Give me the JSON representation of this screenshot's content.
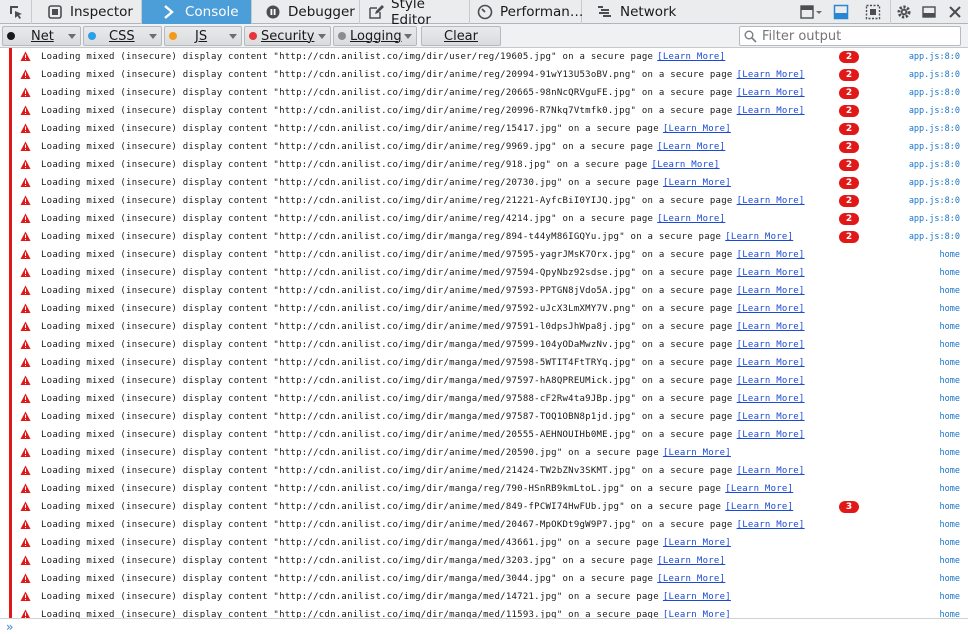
{
  "toolbar": {
    "tabs": [
      {
        "label": "Inspector",
        "icon": "inspector-icon"
      },
      {
        "label": "Console",
        "icon": "console-icon"
      },
      {
        "label": "Debugger",
        "icon": "debugger-icon"
      },
      {
        "label": "Style Editor",
        "icon": "style-editor-icon"
      },
      {
        "label": "Performan…",
        "icon": "performance-icon"
      },
      {
        "label": "Network",
        "icon": "network-icon"
      }
    ],
    "selected_tab": "Console",
    "accent_color": "#4c9ed9"
  },
  "filters": {
    "net": "Net",
    "css": "CSS",
    "js": "JS",
    "security": "Security",
    "logging": "Logging",
    "clear": "Clear",
    "search_placeholder": "Filter output",
    "colors": {
      "net": "#18191a",
      "css": "#2aa0e6",
      "js": "#f39a1b",
      "security": "#e8333a",
      "logging": "#8a8d90"
    }
  },
  "messages": [
    {
      "url": "http://cdn.anilist.co/img/dir/user/reg/19605.jpg",
      "count": "2",
      "location": "app.js:8:0"
    },
    {
      "url": "http://cdn.anilist.co/img/dir/anime/reg/20994-91wY13U53oBV.png",
      "count": "2",
      "location": "app.js:8:0"
    },
    {
      "url": "http://cdn.anilist.co/img/dir/anime/reg/20665-98nNcQRVguFE.jpg",
      "count": "2",
      "location": "app.js:8:0"
    },
    {
      "url": "http://cdn.anilist.co/img/dir/anime/reg/20996-R7Nkq7Vtmfk0.jpg",
      "count": "2",
      "location": "app.js:8:0"
    },
    {
      "url": "http://cdn.anilist.co/img/dir/anime/reg/15417.jpg",
      "count": "2",
      "location": "app.js:8:0"
    },
    {
      "url": "http://cdn.anilist.co/img/dir/anime/reg/9969.jpg",
      "count": "2",
      "location": "app.js:8:0"
    },
    {
      "url": "http://cdn.anilist.co/img/dir/anime/reg/918.jpg",
      "count": "2",
      "location": "app.js:8:0"
    },
    {
      "url": "http://cdn.anilist.co/img/dir/anime/reg/20730.jpg",
      "count": "2",
      "location": "app.js:8:0"
    },
    {
      "url": "http://cdn.anilist.co/img/dir/anime/reg/21221-AyfcBiI0YIJQ.jpg",
      "count": "2",
      "location": "app.js:8:0"
    },
    {
      "url": "http://cdn.anilist.co/img/dir/anime/reg/4214.jpg",
      "count": "2",
      "location": "app.js:8:0"
    },
    {
      "url": "http://cdn.anilist.co/img/dir/manga/reg/894-t44yM86IGQYu.jpg",
      "count": "2",
      "location": "app.js:8:0"
    },
    {
      "url": "http://cdn.anilist.co/img/dir/anime/med/97595-yagrJMsK7Orx.jpg",
      "count": "",
      "location": "home"
    },
    {
      "url": "http://cdn.anilist.co/img/dir/anime/med/97594-QpyNbz92sdse.jpg",
      "count": "",
      "location": "home"
    },
    {
      "url": "http://cdn.anilist.co/img/dir/anime/med/97593-PPTGN8jVdo5A.jpg",
      "count": "",
      "location": "home"
    },
    {
      "url": "http://cdn.anilist.co/img/dir/anime/med/97592-uJcX3LmXMY7V.png",
      "count": "",
      "location": "home"
    },
    {
      "url": "http://cdn.anilist.co/img/dir/anime/med/97591-l0dpsJhWpa8j.jpg",
      "count": "",
      "location": "home"
    },
    {
      "url": "http://cdn.anilist.co/img/dir/manga/med/97599-104yODaMwzNv.jpg",
      "count": "",
      "location": "home"
    },
    {
      "url": "http://cdn.anilist.co/img/dir/manga/med/97598-5WTIT4FtTRYq.jpg",
      "count": "",
      "location": "home"
    },
    {
      "url": "http://cdn.anilist.co/img/dir/manga/med/97597-hA8QPREUMick.jpg",
      "count": "",
      "location": "home"
    },
    {
      "url": "http://cdn.anilist.co/img/dir/manga/med/97588-cF2Rw4ta9JBp.jpg",
      "count": "",
      "location": "home"
    },
    {
      "url": "http://cdn.anilist.co/img/dir/manga/med/97587-TOQ1OBN8p1jd.jpg",
      "count": "",
      "location": "home"
    },
    {
      "url": "http://cdn.anilist.co/img/dir/anime/med/20555-AEHNOUIHb0ME.jpg",
      "count": "",
      "location": "home"
    },
    {
      "url": "http://cdn.anilist.co/img/dir/anime/med/20590.jpg",
      "count": "",
      "location": "home"
    },
    {
      "url": "http://cdn.anilist.co/img/dir/anime/med/21424-TW2bZNv3SKMT.jpg",
      "count": "",
      "location": "home"
    },
    {
      "url": "http://cdn.anilist.co/img/dir/manga/reg/790-HSnRB9kmLtoL.jpg",
      "count": "",
      "location": "home"
    },
    {
      "url": "http://cdn.anilist.co/img/dir/anime/med/849-fPCWI74HwFUb.jpg",
      "count": "3",
      "location": "home"
    },
    {
      "url": "http://cdn.anilist.co/img/dir/anime/med/20467-MpOKDt9gW9P7.jpg",
      "count": "",
      "location": "home"
    },
    {
      "url": "http://cdn.anilist.co/img/dir/manga/med/43661.jpg",
      "count": "",
      "location": "home"
    },
    {
      "url": "http://cdn.anilist.co/img/dir/manga/med/3203.jpg",
      "count": "",
      "location": "home"
    },
    {
      "url": "http://cdn.anilist.co/img/dir/manga/med/3044.jpg",
      "count": "",
      "location": "home"
    },
    {
      "url": "http://cdn.anilist.co/img/dir/manga/med/14721.jpg",
      "count": "",
      "location": "home"
    },
    {
      "url": "http://cdn.anilist.co/img/dir/manga/med/11593.jpg",
      "count": "",
      "location": "home"
    }
  ],
  "message_text": {
    "prefix": "Loading mixed (insecure) display content \"",
    "suffix": "\" on a secure page",
    "learn_more": "[Learn More]"
  },
  "input": {
    "prompt": "»"
  }
}
